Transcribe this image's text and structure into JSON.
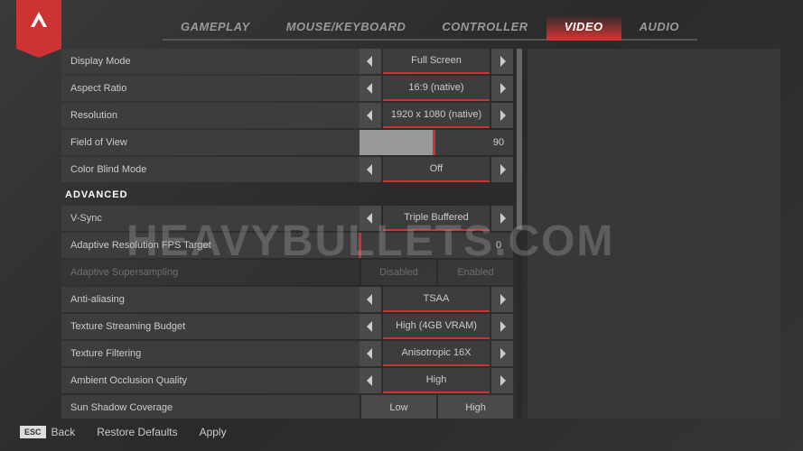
{
  "tabs": [
    "GAMEPLAY",
    "MOUSE/KEYBOARD",
    "CONTROLLER",
    "VIDEO",
    "AUDIO"
  ],
  "activeTab": "VIDEO",
  "sections": {
    "advanced": "ADVANCED"
  },
  "settings": {
    "displayMode": {
      "label": "Display Mode",
      "value": "Full Screen"
    },
    "aspectRatio": {
      "label": "Aspect Ratio",
      "value": "16:9 (native)"
    },
    "resolution": {
      "label": "Resolution",
      "value": "1920 x 1080 (native)"
    },
    "fov": {
      "label": "Field of View",
      "value": "90",
      "percent": 60
    },
    "colorBlind": {
      "label": "Color Blind Mode",
      "value": "Off"
    },
    "vsync": {
      "label": "V-Sync",
      "value": "Triple Buffered"
    },
    "adaptiveRes": {
      "label": "Adaptive Resolution FPS Target",
      "value": "0",
      "percent": 0
    },
    "adaptiveSS": {
      "label": "Adaptive Supersampling",
      "options": [
        "Disabled",
        "Enabled"
      ]
    },
    "antiAliasing": {
      "label": "Anti-aliasing",
      "value": "TSAA"
    },
    "textureBudget": {
      "label": "Texture Streaming Budget",
      "value": "High (4GB VRAM)"
    },
    "textureFilter": {
      "label": "Texture Filtering",
      "value": "Anisotropic 16X"
    },
    "ambientOcclusion": {
      "label": "Ambient Occlusion Quality",
      "value": "High"
    },
    "sunShadow": {
      "label": "Sun Shadow Coverage",
      "options": [
        "Low",
        "High"
      ]
    }
  },
  "footer": {
    "esc": "ESC",
    "back": "Back",
    "restore": "Restore Defaults",
    "apply": "Apply"
  },
  "watermark": "HEAVYBULLETS.COM"
}
